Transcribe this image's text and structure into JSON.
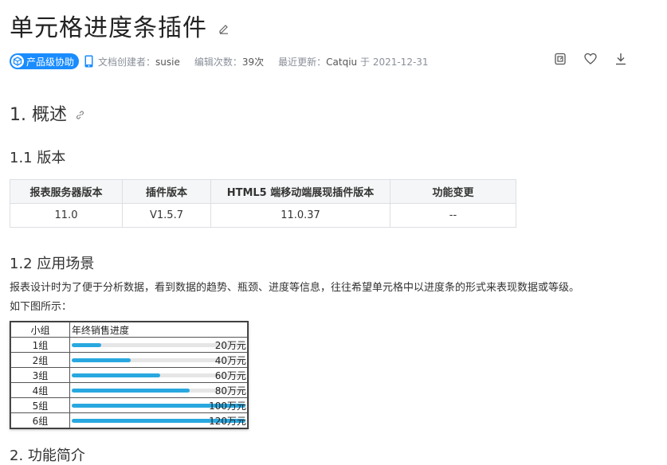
{
  "page": {
    "title": "单元格进度条插件",
    "badge": "产品级协助",
    "meta": {
      "creator_label": "文档创建者：",
      "creator": "susie",
      "edits_label": "编辑次数：",
      "edits": "39次",
      "updated_label": "最近更新：",
      "updated_by": "Catqiu",
      "updated_on": "于 2021-12-31"
    }
  },
  "section1": {
    "title": "1. 概述"
  },
  "section1_1": {
    "title": "1.1 版本",
    "headers": [
      "报表服务器版本",
      "插件版本",
      "HTML5 端移动端展现插件版本",
      "功能变更"
    ],
    "row": [
      "11.0",
      "V1.5.7",
      "11.0.37",
      "--"
    ]
  },
  "section1_2": {
    "title": "1.2 应用场景",
    "paragraph_1": "报表设计时为了便于分析数据，看到数据的趋势、瓶颈、进度等信息，往往希望单元格中以进度条的形式来表现数据或等级。",
    "paragraph_2": "如下图所示："
  },
  "figure": {
    "col_group": "小组",
    "col_progress": "年终销售进度",
    "rows": [
      {
        "group": "1组",
        "label": "20万元",
        "progress": 0.17
      },
      {
        "group": "2组",
        "label": "40万元",
        "progress": 0.34
      },
      {
        "group": "3组",
        "label": "60万元",
        "progress": 0.51
      },
      {
        "group": "4组",
        "label": "80万元",
        "progress": 0.68
      },
      {
        "group": "5组",
        "label": "100万元",
        "progress": 1.0
      },
      {
        "group": "6组",
        "label": "120万元",
        "progress": 1.0
      }
    ]
  },
  "colors": {
    "accent": "#1a8cff",
    "bar": "#29a8e0"
  },
  "icons": [
    "edit-icon",
    "mobile-icon",
    "copy-icon",
    "heart-icon",
    "download-icon",
    "link-icon"
  ]
}
